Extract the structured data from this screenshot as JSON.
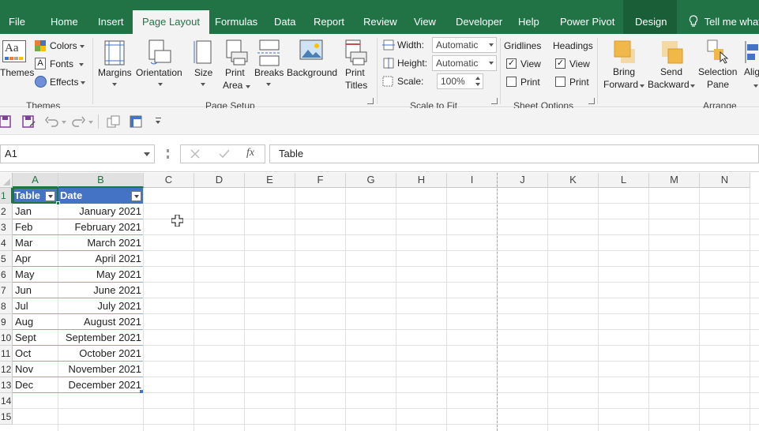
{
  "tabs": [
    "File",
    "Home",
    "Insert",
    "Page Layout",
    "Formulas",
    "Data",
    "Report",
    "Review",
    "View",
    "Developer",
    "Help",
    "Power Pivot",
    "Design"
  ],
  "tell_me": "Tell me what y",
  "ribbon": {
    "themes": {
      "themes_label": "Themes",
      "colors_label": "Colors",
      "fonts_label": "Fonts",
      "effects_label": "Effects",
      "group": "Themes"
    },
    "page_setup": {
      "margins": "Margins",
      "orientation": "Orientation",
      "size": "Size",
      "print_area_1": "Print",
      "print_area_2": "Area",
      "breaks": "Breaks",
      "background": "Background",
      "print_titles_1": "Print",
      "print_titles_2": "Titles",
      "group": "Page Setup"
    },
    "scale": {
      "width_label": "Width:",
      "width_value": "Automatic",
      "height_label": "Height:",
      "height_value": "Automatic",
      "scale_label": "Scale:",
      "scale_value": "100%",
      "group": "Scale to Fit"
    },
    "sheet_options": {
      "gridlines": "Gridlines",
      "headings": "Headings",
      "view": "View",
      "print": "Print",
      "group": "Sheet Options",
      "gridlines_view": true,
      "gridlines_print": false,
      "headings_view": true,
      "headings_print": false
    },
    "arrange": {
      "bring_forward_1": "Bring",
      "bring_forward_2": "Forward",
      "send_backward_1": "Send",
      "send_backward_2": "Backward",
      "selection_pane_1": "Selection",
      "selection_pane_2": "Pane",
      "align": "Alig",
      "group": "Arrange"
    }
  },
  "name_box": "A1",
  "formula": "Table",
  "columns": [
    "A",
    "B",
    "C",
    "D",
    "E",
    "F",
    "G",
    "H",
    "I",
    "J",
    "K",
    "L",
    "M",
    "N"
  ],
  "rows": [
    "1",
    "2",
    "3",
    "4",
    "5",
    "6",
    "7",
    "8",
    "9",
    "10",
    "11",
    "12",
    "13",
    "14",
    "15"
  ],
  "table": {
    "headers": [
      "Table",
      "Date"
    ],
    "rows": [
      [
        "Jan",
        "January 2021"
      ],
      [
        "Feb",
        "February 2021"
      ],
      [
        "Mar",
        "March 2021"
      ],
      [
        "Apr",
        "April 2021"
      ],
      [
        "May",
        "May 2021"
      ],
      [
        "Jun",
        "June 2021"
      ],
      [
        "Jul",
        "July 2021"
      ],
      [
        "Aug",
        "August 2021"
      ],
      [
        "Sept",
        "September 2021"
      ],
      [
        "Oct",
        "October 2021"
      ],
      [
        "Nov",
        "November 2021"
      ],
      [
        "Dec",
        "December 2021"
      ]
    ]
  },
  "colors": {
    "accent": "#217346",
    "table_header": "#4472c4"
  }
}
